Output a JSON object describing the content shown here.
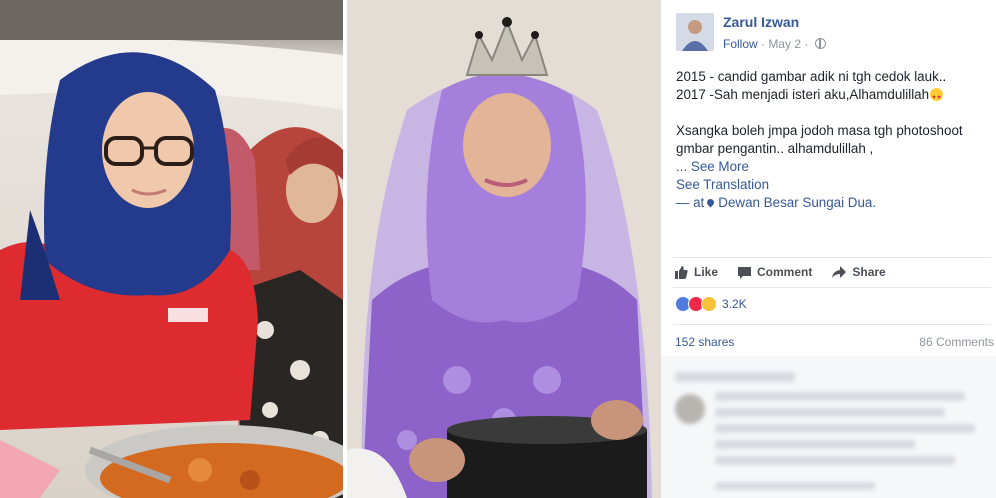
{
  "post": {
    "author_name": "Zarul Izwan",
    "follow_label": "Follow",
    "meta_separator": " · ",
    "date": "May 2",
    "separator_2": " · ",
    "line1": "2015 - candid gambar adik ni tgh cedok lauk..",
    "line2": "2017 -Sah menjadi isteri aku,Alhamdulillah",
    "line3": "Xsangka boleh jmpa jodoh masa tgh photoshoot",
    "line4": "gmbar pengantin.. alhamdulillah ,",
    "ellipsis": "... ",
    "see_more": "See More",
    "see_translation": "See Translation",
    "location_prefix": "— at",
    "location": "Dewan Besar Sungai Dua."
  },
  "actions": {
    "like": "Like",
    "comment": "Comment",
    "share": "Share"
  },
  "stats": {
    "reaction_count": "3.2K",
    "shares": "152 shares",
    "comments": "86 Comments"
  },
  "icons": [
    "thumbs-up-icon",
    "comment-icon",
    "share-icon",
    "globe-icon",
    "location-pin-icon",
    "heart-eyes-emoji-icon",
    "like-reaction-icon",
    "love-reaction-icon",
    "wow-reaction-icon"
  ],
  "colors": {
    "link_blue": "#365899",
    "text": "#1d2129",
    "muted": "#90949c",
    "action_gray": "#4b4f56"
  }
}
